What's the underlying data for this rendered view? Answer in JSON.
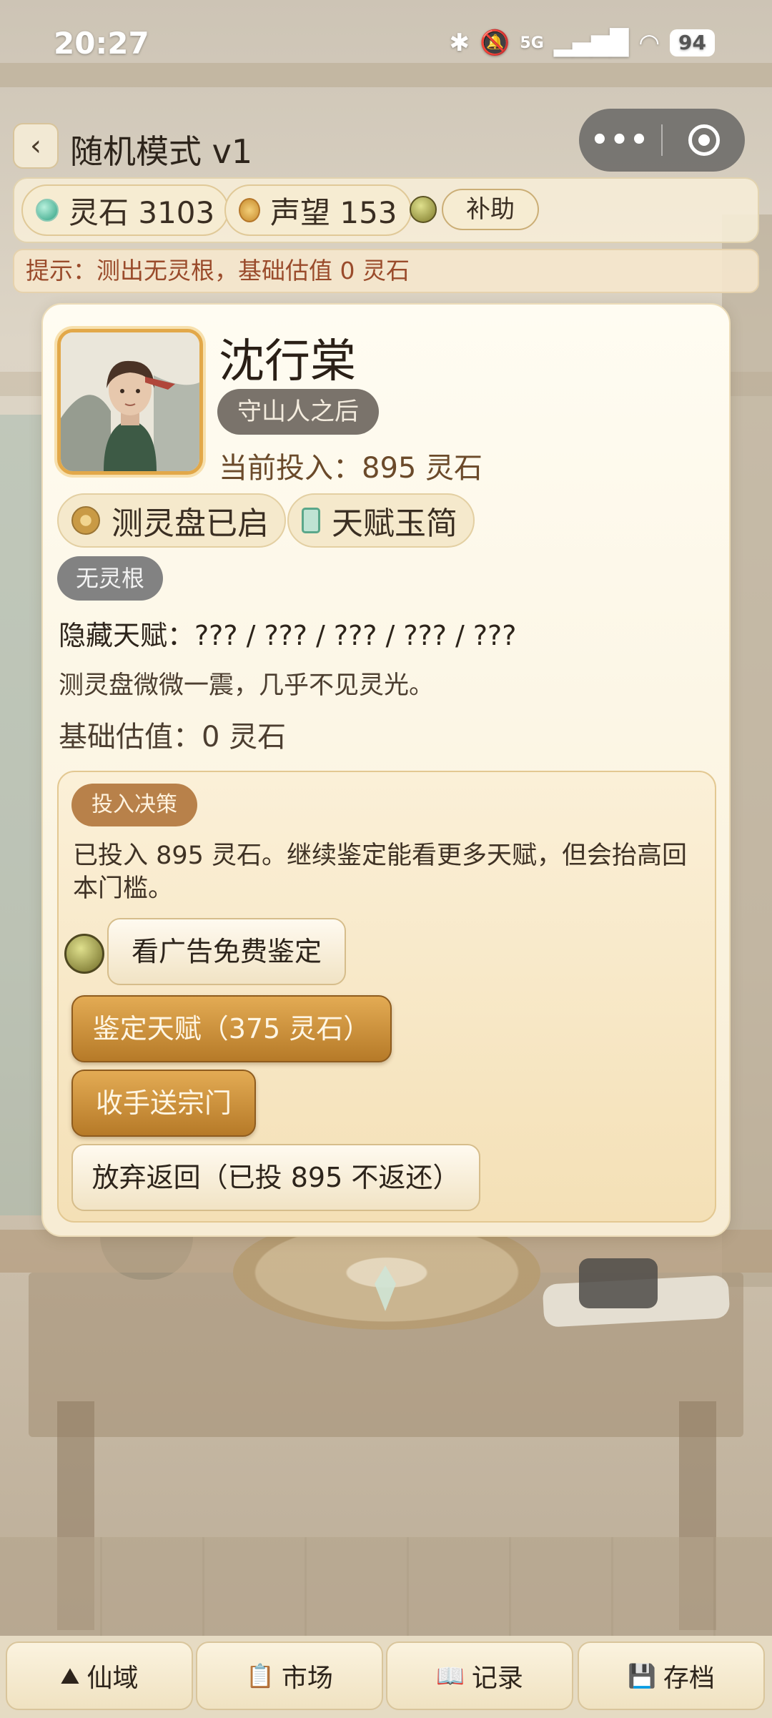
{
  "status_bar": {
    "time": "20:27",
    "network": "5G",
    "battery": "94"
  },
  "header": {
    "back_label": "‹",
    "title": "随机模式 v1",
    "capsule_more": "•••"
  },
  "resources": {
    "spirit_stone": "灵石 3103",
    "reputation": "声望 153",
    "aid_label": "补助"
  },
  "hint": "提示：测出无灵根，基础估值 0 灵石",
  "character": {
    "name": "沈行棠",
    "origin": "守山人之后",
    "investment": "当前投入：895 灵石",
    "tool_plate": "测灵盘已启",
    "tool_slip": "天赋玉简",
    "root": "无灵根",
    "hidden_talent": "隐藏天赋：??? / ??? / ??? / ??? / ???",
    "flavor": "测灵盘微微一震，几乎不见灵光。",
    "base_estimate": "基础估值：0 灵石"
  },
  "decision": {
    "tag": "投入决策",
    "description": "已投入 895 灵石。继续鉴定能看更多天赋，但会抬高回本门槛。",
    "ad_button": "看广告免费鉴定",
    "appraise_button": "鉴定天赋（375 灵石）",
    "send_button": "收手送宗门",
    "abandon_button": "放弃返回（已投 895 不返还）"
  },
  "bottom_nav": [
    {
      "icon": "⛰",
      "label": "仙域"
    },
    {
      "icon": "📋",
      "label": "市场"
    },
    {
      "icon": "📖",
      "label": "记录"
    },
    {
      "icon": "💾",
      "label": "存档"
    }
  ],
  "colors": {
    "accent_gold": "#b67a28",
    "hint_text": "#9a4b2b",
    "badge_gray": "#828282"
  }
}
